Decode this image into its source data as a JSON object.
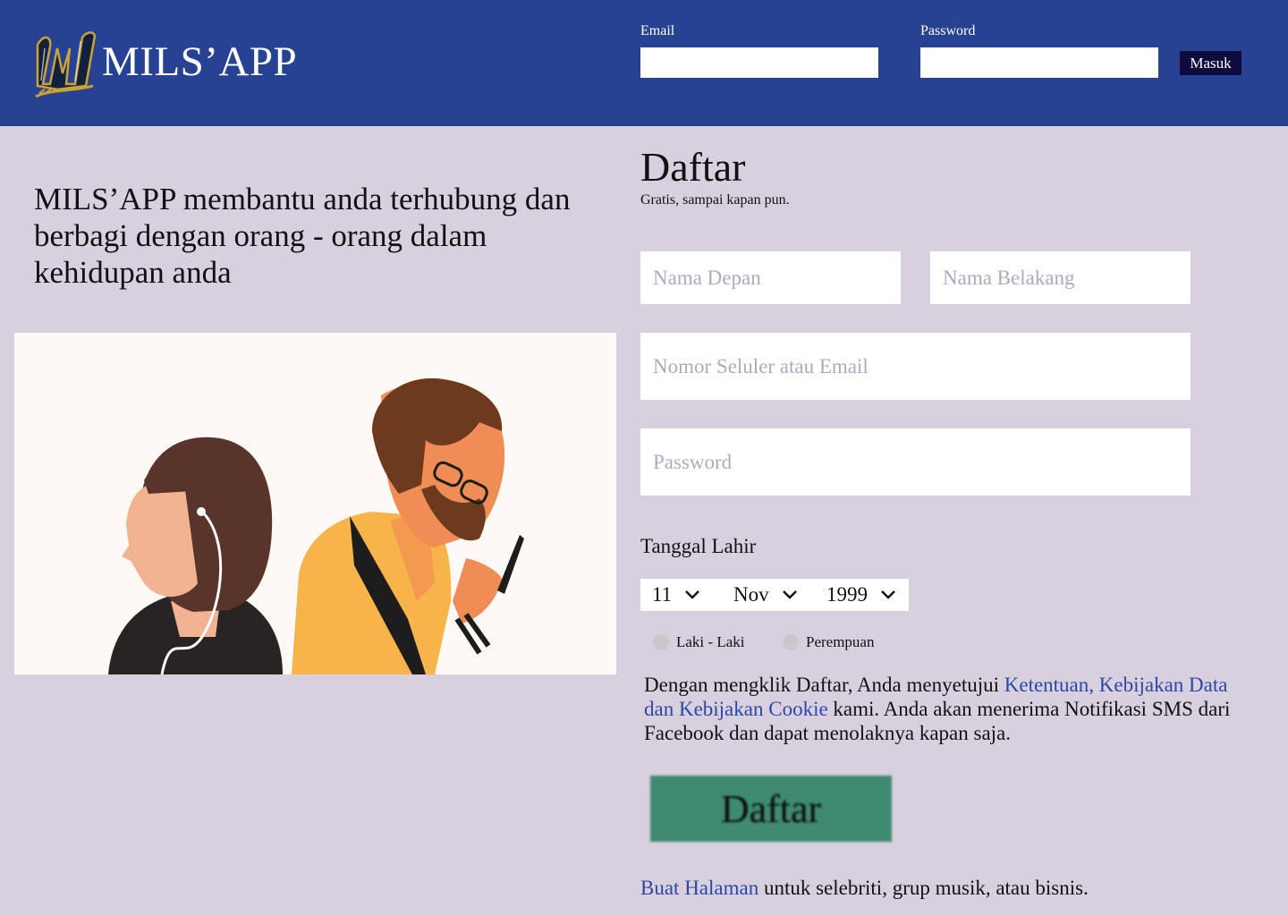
{
  "header": {
    "app_name": "MILS’APP",
    "logo_icon": "brewers-m-logo",
    "email_label": "Email",
    "email_value": "",
    "password_label": "Password",
    "password_value": "",
    "login_button": "Masuk"
  },
  "hero": {
    "tagline": "MILS’APP membantu anda terhubung dan berbagi dengan orang - orang dalam kehidupan anda",
    "illustration": "two-people-illustration"
  },
  "register": {
    "title": "Daftar",
    "subtitle": "Gratis, sampai kapan pun.",
    "first_name_placeholder": "Nama Depan",
    "last_name_placeholder": "Nama Belakang",
    "contact_placeholder": "Nomor Seluler atau Email",
    "password_placeholder": "Password",
    "dob_label": "Tanggal Lahir",
    "dob_day": "11",
    "dob_month": "Nov",
    "dob_year": "1999",
    "gender_male": "Laki - Laki",
    "gender_female": "Perempuan",
    "terms_prefix": "Dengan mengklik Daftar, Anda menyetujui ",
    "terms_link": "Ketentuan, Kebijakan Data dan Kebijakan Cookie",
    "terms_suffix": " kami. Anda akan menerima Notifikasi SMS dari Facebook dan dapat menolaknya kapan saja.",
    "submit_button": "Daftar",
    "page_link": "Buat Halaman",
    "page_text": " untuk selebriti, grup musik, atau bisnis."
  },
  "colors": {
    "header_bg": "#284293",
    "page_bg": "#d9d0df",
    "login_button_bg": "#0e0b3e",
    "submit_bg": "#3f8a70",
    "link": "#2b48a5"
  }
}
